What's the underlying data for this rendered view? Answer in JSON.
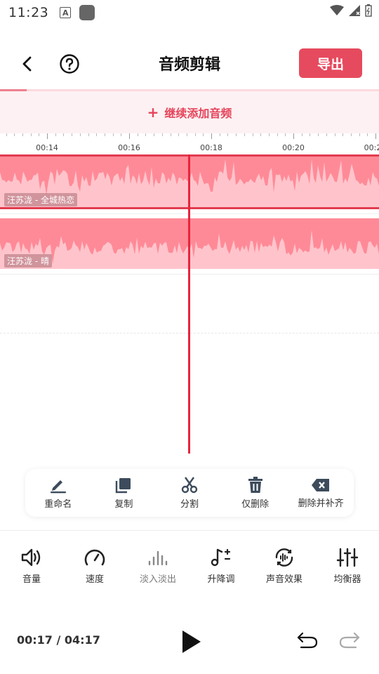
{
  "status_bar": {
    "time": "11:23",
    "notification_icon_a": "A"
  },
  "header": {
    "title": "音频剪辑",
    "export_label": "导出",
    "back_icon": "back-arrow-icon",
    "help_icon": "question-circle-icon"
  },
  "add_audio": {
    "plus": "+",
    "label": "继续添加音频"
  },
  "timeline": {
    "ticks": [
      "00:14",
      "00:16",
      "00:18",
      "00:20",
      "00:2"
    ],
    "playback_progress": 0.07
  },
  "tracks": [
    {
      "label": "汪苏泷 - 全城热恋",
      "selected": true
    },
    {
      "label": "汪苏泷 - 晴",
      "selected": false
    }
  ],
  "edit_tools": [
    {
      "icon": "pencil-icon",
      "label": "重命名"
    },
    {
      "icon": "copy-icon",
      "label": "复制"
    },
    {
      "icon": "scissors-icon",
      "label": "分割"
    },
    {
      "icon": "trash-icon",
      "label": "仅删除"
    },
    {
      "icon": "backspace-icon",
      "label": "删除并补齐"
    }
  ],
  "effect_tools": [
    {
      "icon": "volume-icon",
      "label": "音量"
    },
    {
      "icon": "speedometer-icon",
      "label": "速度"
    },
    {
      "icon": "fade-bars-icon",
      "label": "淡入淡出"
    },
    {
      "icon": "pitch-note-icon",
      "label": "升降调"
    },
    {
      "icon": "sound-effect-icon",
      "label": "声音效果"
    },
    {
      "icon": "equalizer-icon",
      "label": "均衡器"
    }
  ],
  "playback": {
    "time": "00:17 / 04:17",
    "play_icon": "play-icon",
    "undo_icon": "undo-icon",
    "redo_icon": "redo-icon"
  },
  "colors": {
    "accent": "#e64a5e",
    "track_fill": "#ff8a97",
    "waveform": "#ffc4cb",
    "playhead": "#e8243c"
  }
}
